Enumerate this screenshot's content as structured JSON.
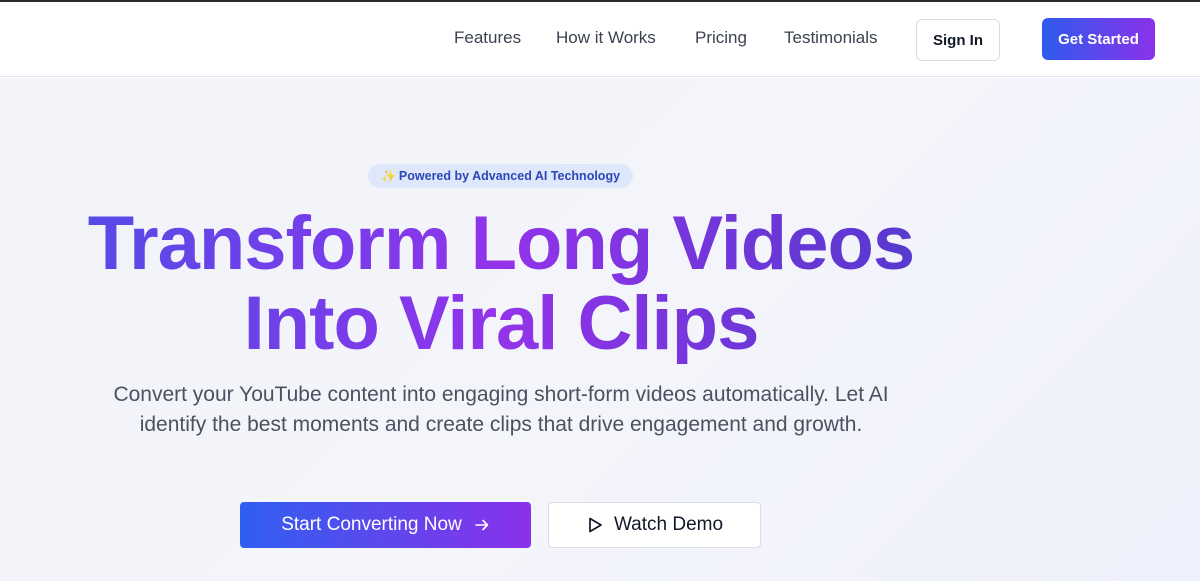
{
  "nav": {
    "links": [
      "Features",
      "How it Works",
      "Pricing",
      "Testimonials"
    ],
    "sign_in": "Sign In",
    "get_started": "Get Started"
  },
  "hero": {
    "badge_icon": "sparkles-icon",
    "badge_text": "Powered by Advanced AI Technology",
    "headline_line1": "Transform Long Videos",
    "headline_line2": "Into Viral Clips",
    "subtext": "Convert your YouTube content into engaging short-form videos automatically. Let AI identify the best moments and create clips that drive engagement and growth.",
    "primary_cta": "Start Converting Now",
    "secondary_cta": "Watch Demo"
  },
  "colors": {
    "gradient_start": "#2e5bed",
    "gradient_end": "#8a32ea",
    "badge_bg": "#dfe7fa",
    "badge_text": "#2b47b9"
  }
}
